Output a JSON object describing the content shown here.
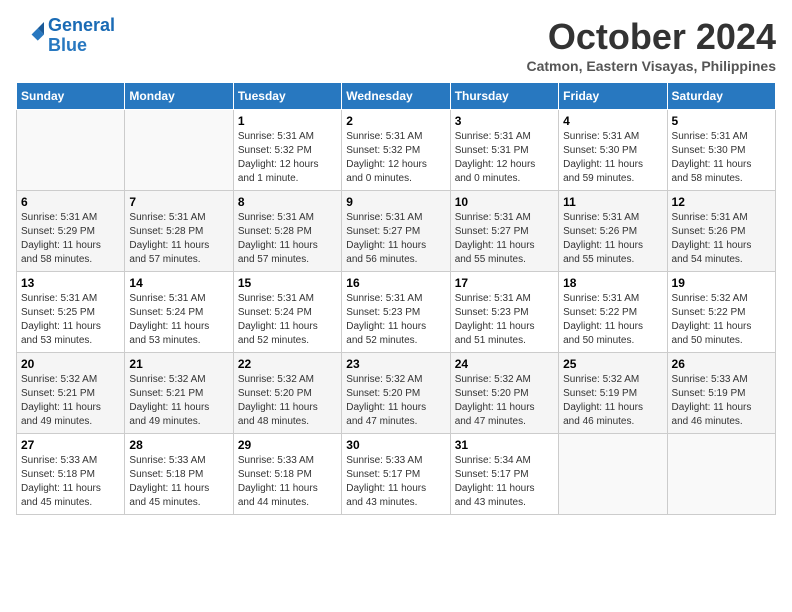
{
  "header": {
    "logo_line1": "General",
    "logo_line2": "Blue",
    "month": "October 2024",
    "location": "Catmon, Eastern Visayas, Philippines"
  },
  "weekdays": [
    "Sunday",
    "Monday",
    "Tuesday",
    "Wednesday",
    "Thursday",
    "Friday",
    "Saturday"
  ],
  "weeks": [
    [
      {
        "day": "",
        "info": ""
      },
      {
        "day": "",
        "info": ""
      },
      {
        "day": "1",
        "info": "Sunrise: 5:31 AM\nSunset: 5:32 PM\nDaylight: 12 hours\nand 1 minute."
      },
      {
        "day": "2",
        "info": "Sunrise: 5:31 AM\nSunset: 5:32 PM\nDaylight: 12 hours\nand 0 minutes."
      },
      {
        "day": "3",
        "info": "Sunrise: 5:31 AM\nSunset: 5:31 PM\nDaylight: 12 hours\nand 0 minutes."
      },
      {
        "day": "4",
        "info": "Sunrise: 5:31 AM\nSunset: 5:30 PM\nDaylight: 11 hours\nand 59 minutes."
      },
      {
        "day": "5",
        "info": "Sunrise: 5:31 AM\nSunset: 5:30 PM\nDaylight: 11 hours\nand 58 minutes."
      }
    ],
    [
      {
        "day": "6",
        "info": "Sunrise: 5:31 AM\nSunset: 5:29 PM\nDaylight: 11 hours\nand 58 minutes."
      },
      {
        "day": "7",
        "info": "Sunrise: 5:31 AM\nSunset: 5:28 PM\nDaylight: 11 hours\nand 57 minutes."
      },
      {
        "day": "8",
        "info": "Sunrise: 5:31 AM\nSunset: 5:28 PM\nDaylight: 11 hours\nand 57 minutes."
      },
      {
        "day": "9",
        "info": "Sunrise: 5:31 AM\nSunset: 5:27 PM\nDaylight: 11 hours\nand 56 minutes."
      },
      {
        "day": "10",
        "info": "Sunrise: 5:31 AM\nSunset: 5:27 PM\nDaylight: 11 hours\nand 55 minutes."
      },
      {
        "day": "11",
        "info": "Sunrise: 5:31 AM\nSunset: 5:26 PM\nDaylight: 11 hours\nand 55 minutes."
      },
      {
        "day": "12",
        "info": "Sunrise: 5:31 AM\nSunset: 5:26 PM\nDaylight: 11 hours\nand 54 minutes."
      }
    ],
    [
      {
        "day": "13",
        "info": "Sunrise: 5:31 AM\nSunset: 5:25 PM\nDaylight: 11 hours\nand 53 minutes."
      },
      {
        "day": "14",
        "info": "Sunrise: 5:31 AM\nSunset: 5:24 PM\nDaylight: 11 hours\nand 53 minutes."
      },
      {
        "day": "15",
        "info": "Sunrise: 5:31 AM\nSunset: 5:24 PM\nDaylight: 11 hours\nand 52 minutes."
      },
      {
        "day": "16",
        "info": "Sunrise: 5:31 AM\nSunset: 5:23 PM\nDaylight: 11 hours\nand 52 minutes."
      },
      {
        "day": "17",
        "info": "Sunrise: 5:31 AM\nSunset: 5:23 PM\nDaylight: 11 hours\nand 51 minutes."
      },
      {
        "day": "18",
        "info": "Sunrise: 5:31 AM\nSunset: 5:22 PM\nDaylight: 11 hours\nand 50 minutes."
      },
      {
        "day": "19",
        "info": "Sunrise: 5:32 AM\nSunset: 5:22 PM\nDaylight: 11 hours\nand 50 minutes."
      }
    ],
    [
      {
        "day": "20",
        "info": "Sunrise: 5:32 AM\nSunset: 5:21 PM\nDaylight: 11 hours\nand 49 minutes."
      },
      {
        "day": "21",
        "info": "Sunrise: 5:32 AM\nSunset: 5:21 PM\nDaylight: 11 hours\nand 49 minutes."
      },
      {
        "day": "22",
        "info": "Sunrise: 5:32 AM\nSunset: 5:20 PM\nDaylight: 11 hours\nand 48 minutes."
      },
      {
        "day": "23",
        "info": "Sunrise: 5:32 AM\nSunset: 5:20 PM\nDaylight: 11 hours\nand 47 minutes."
      },
      {
        "day": "24",
        "info": "Sunrise: 5:32 AM\nSunset: 5:20 PM\nDaylight: 11 hours\nand 47 minutes."
      },
      {
        "day": "25",
        "info": "Sunrise: 5:32 AM\nSunset: 5:19 PM\nDaylight: 11 hours\nand 46 minutes."
      },
      {
        "day": "26",
        "info": "Sunrise: 5:33 AM\nSunset: 5:19 PM\nDaylight: 11 hours\nand 46 minutes."
      }
    ],
    [
      {
        "day": "27",
        "info": "Sunrise: 5:33 AM\nSunset: 5:18 PM\nDaylight: 11 hours\nand 45 minutes."
      },
      {
        "day": "28",
        "info": "Sunrise: 5:33 AM\nSunset: 5:18 PM\nDaylight: 11 hours\nand 45 minutes."
      },
      {
        "day": "29",
        "info": "Sunrise: 5:33 AM\nSunset: 5:18 PM\nDaylight: 11 hours\nand 44 minutes."
      },
      {
        "day": "30",
        "info": "Sunrise: 5:33 AM\nSunset: 5:17 PM\nDaylight: 11 hours\nand 43 minutes."
      },
      {
        "day": "31",
        "info": "Sunrise: 5:34 AM\nSunset: 5:17 PM\nDaylight: 11 hours\nand 43 minutes."
      },
      {
        "day": "",
        "info": ""
      },
      {
        "day": "",
        "info": ""
      }
    ]
  ]
}
